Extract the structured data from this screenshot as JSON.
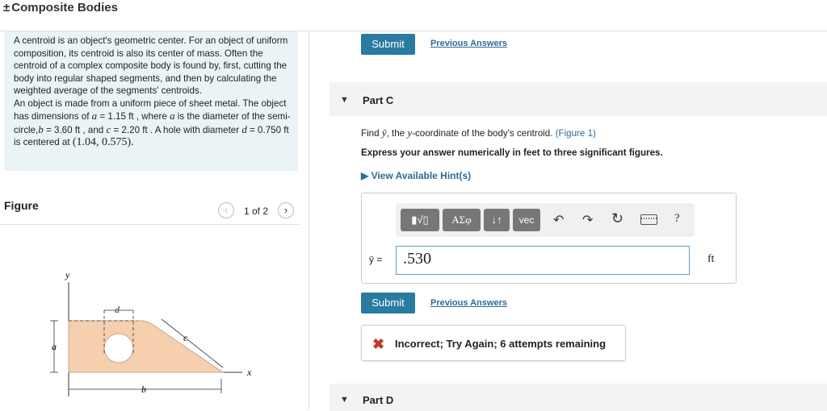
{
  "header": {
    "prefix": "±",
    "title": "Composite Bodies"
  },
  "intro": {
    "p1": "A centroid is an object's geometric center. For an object of uniform composition, its centroid is also its center of mass. Often the centroid of a complex composite body is found by, first, cutting the body into regular shaped segments, and then by calculating the weighted average of the segments' centroids.",
    "p2_a": "An object is made from a uniform piece of sheet metal. The object has dimensions of ",
    "var_a": "a",
    "p2_b": " = 1.15 ft , where ",
    "var_a2": "a",
    "p2_c": " is the diameter of the semi-circle,",
    "var_b": "b",
    "p2_d": " = 3.60 ft , and ",
    "var_c": "c",
    "p2_e": " = 2.20 ft . A hole with diameter ",
    "var_d": "d",
    "p2_f": " = 0.750 ft is centered at ",
    "point": "(1.04, 0.575)."
  },
  "figure": {
    "label": "Figure",
    "counter": "1 of 2",
    "prev_icon": "chevron-left-icon",
    "next_icon": "chevron-right-icon",
    "labels": {
      "y": "y",
      "x": "x",
      "a": "a",
      "b": "b",
      "c": "c",
      "d": "d"
    },
    "fill_color": "#f5cfae"
  },
  "top": {
    "submit": "Submit",
    "previous_answers": "Previous Answers"
  },
  "partC": {
    "label": "Part C",
    "question_a": "Find ",
    "question_var": "ȳ",
    "question_b": ", the ",
    "question_var2": "y",
    "question_c": "-coordinate of the body's centroid. ",
    "figure_link": "(Figure 1)",
    "instruction": "Express your answer numerically in feet to three significant figures.",
    "hints": "View Available Hint(s)",
    "toolbar": {
      "templates": "▮√▯",
      "symbols": "ΑΣφ",
      "arrows": "↓↑",
      "vec": "vec",
      "undo_icon": "undo-icon",
      "redo_icon": "redo-icon",
      "reset_icon": "reset-icon",
      "keyboard_icon": "keyboard-icon",
      "help": "?"
    },
    "variable": "ȳ =",
    "answer": ".530",
    "unit": "ft",
    "submit": "Submit",
    "previous_answers": "Previous Answers",
    "feedback": "Incorrect; Try Again; 6 attempts remaining",
    "feedback_color": "#c0392b"
  },
  "partD": {
    "label": "Part D"
  },
  "colors": {
    "accent": "#2a7ba0",
    "link": "#2b6c95",
    "intro_bg": "#eaf4f7"
  }
}
